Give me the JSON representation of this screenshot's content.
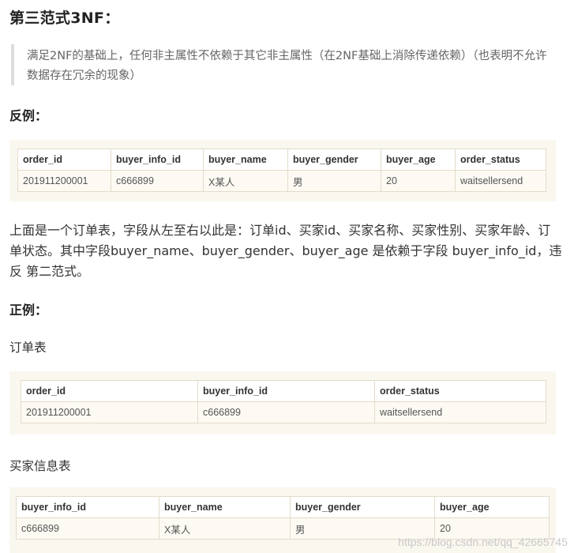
{
  "title": "第三范式3NF：",
  "quote": "满足2NF的基础上，任何非主属性不依赖于其它非主属性（在2NF基础上消除传递依赖）（也表明不允许数据存在冗余的现象）",
  "negative_heading": "反例：",
  "table1": {
    "headers": [
      "order_id",
      "buyer_info_id",
      "buyer_name",
      "buyer_gender",
      "buyer_age",
      "order_status"
    ],
    "rows": [
      [
        "201911200001",
        "c666899",
        "X某人",
        "男",
        "20",
        "waitsellersend"
      ]
    ]
  },
  "explanation": "上面是一个订单表，字段从左至右以此是：订单id、买家id、买家名称、买家性别、买家年龄、订单状态。其中字段buyer_name、buyer_gender、buyer_age 是依赖于字段 buyer_info_id，违反 第二范式。",
  "positive_heading": "正例：",
  "order_table_label": "订单表",
  "table2": {
    "headers": [
      "order_id",
      "buyer_info_id",
      "order_status"
    ],
    "rows": [
      [
        "201911200001",
        "c666899",
        "waitsellersend"
      ]
    ]
  },
  "buyer_table_label": "买家信息表",
  "table3": {
    "headers": [
      "buyer_info_id",
      "buyer_name",
      "buyer_gender",
      "buyer_age"
    ],
    "rows": [
      [
        "c666899",
        "X某人",
        "男",
        "20"
      ]
    ]
  },
  "watermark": "https://blog.csdn.net/qq_42665745"
}
